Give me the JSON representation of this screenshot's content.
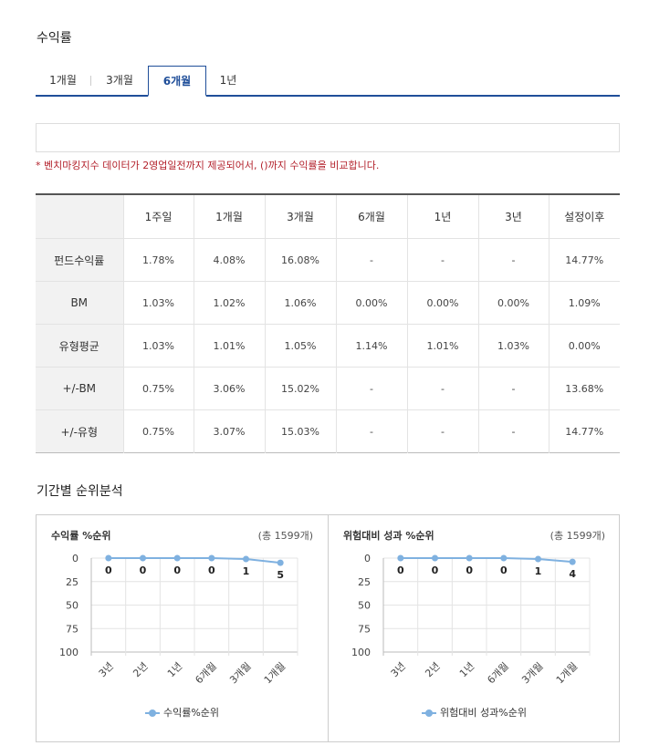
{
  "section_returns": "수익률",
  "tabs": [
    {
      "label": "1개월",
      "active": false
    },
    {
      "label": "3개월",
      "active": false
    },
    {
      "label": "6개월",
      "active": true
    },
    {
      "label": "1년",
      "active": false
    }
  ],
  "note": "* 벤치마킹지수 데이터가 2영업일전까지 제공되어서, ()까지 수익률을 비교합니다.",
  "table": {
    "headers": [
      "",
      "1주일",
      "1개월",
      "3개월",
      "6개월",
      "1년",
      "3년",
      "설정이후"
    ],
    "rows": [
      [
        "펀드수익률",
        "1.78%",
        "4.08%",
        "16.08%",
        "-",
        "-",
        "-",
        "14.77%"
      ],
      [
        "BM",
        "1.03%",
        "1.02%",
        "1.06%",
        "0.00%",
        "0.00%",
        "0.00%",
        "1.09%"
      ],
      [
        "유형평균",
        "1.03%",
        "1.01%",
        "1.05%",
        "1.14%",
        "1.01%",
        "1.03%",
        "0.00%"
      ],
      [
        "+/-BM",
        "0.75%",
        "3.06%",
        "15.02%",
        "-",
        "-",
        "-",
        "13.68%"
      ],
      [
        "+/-유형",
        "0.75%",
        "3.07%",
        "15.03%",
        "-",
        "-",
        "-",
        "14.77%"
      ]
    ]
  },
  "section_rank": "기간별 순위분석",
  "chart_data": [
    {
      "type": "line",
      "title": "수익률 %순위",
      "total": "(총 1599개)",
      "categories": [
        "3년",
        "2년",
        "1년",
        "6개월",
        "3개월",
        "1개월"
      ],
      "series": [
        {
          "name": "수익률%순위",
          "values": [
            0,
            0,
            0,
            0,
            1,
            5
          ]
        }
      ],
      "yticks": [
        0,
        25,
        50,
        75,
        100
      ],
      "ylim": [
        0,
        100
      ],
      "y_inverted": true,
      "grid": true,
      "legend": "bottom",
      "color": "#7fb1e0"
    },
    {
      "type": "line",
      "title": "위험대비 성과 %순위",
      "total": "(총 1599개)",
      "categories": [
        "3년",
        "2년",
        "1년",
        "6개월",
        "3개월",
        "1개월"
      ],
      "series": [
        {
          "name": "위험대비 성과%순위",
          "values": [
            0,
            0,
            0,
            0,
            1,
            4
          ]
        }
      ],
      "yticks": [
        0,
        25,
        50,
        75,
        100
      ],
      "ylim": [
        0,
        100
      ],
      "y_inverted": true,
      "grid": true,
      "legend": "bottom",
      "color": "#7fb1e0"
    }
  ]
}
